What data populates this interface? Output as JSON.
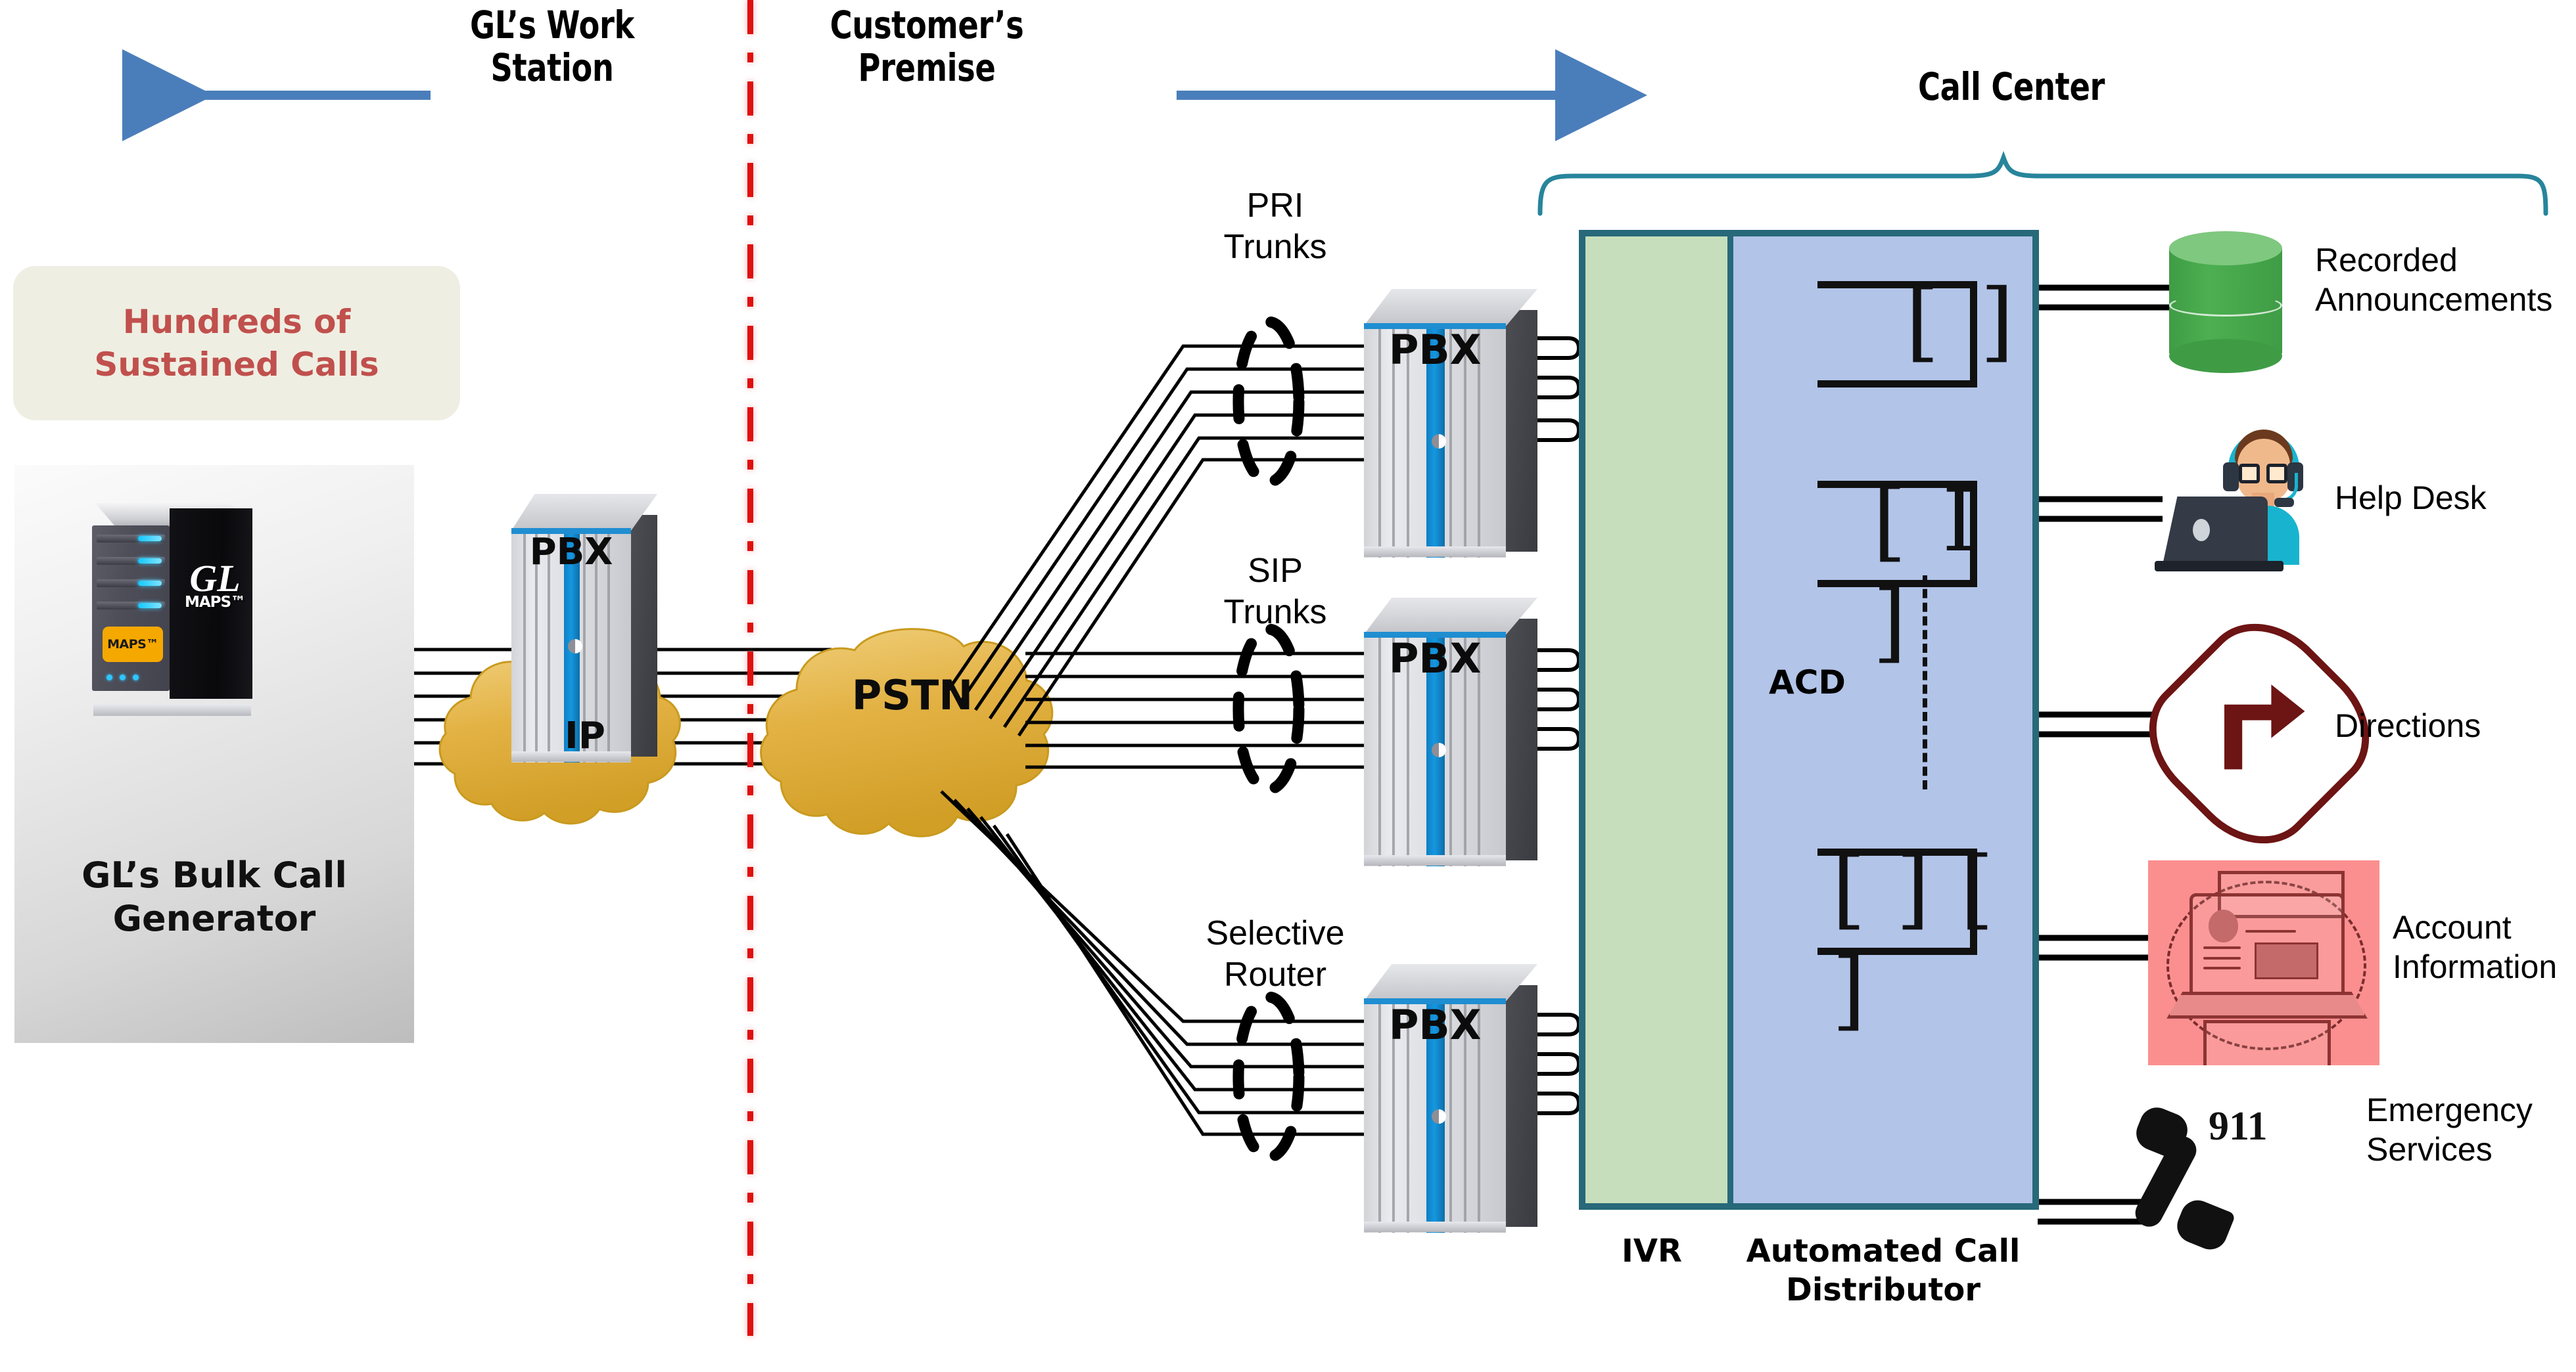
{
  "sections": {
    "workstation": {
      "title": "GL’s Work\nStation",
      "arrow": "left-arrow"
    },
    "premise": {
      "title": "Customer’s\nPremise",
      "arrow": "right-arrow"
    },
    "callcenter": {
      "title": "Call Center",
      "brace": "curly-brace"
    }
  },
  "callout": {
    "text": "Hundreds of\nSustained Calls"
  },
  "generator": {
    "caption": "GL’s Bulk Call\nGenerator",
    "logo_main": "GL",
    "logo_sub": "MAPS™",
    "badge": "MAPS™"
  },
  "clouds": [
    {
      "name": "ip-cloud",
      "label": "IP",
      "color": "#e0ad3c"
    },
    {
      "name": "pstn-cloud",
      "label": "PSTN",
      "color": "#e0ad3c"
    }
  ],
  "edge_pbx": {
    "label": "PBX"
  },
  "trunks": [
    {
      "label": "PRI\nTrunks",
      "pbx_label": "PBX"
    },
    {
      "label": "SIP\nTrunks",
      "pbx_label": "PBX"
    },
    {
      "label": "Selective\nRouter",
      "pbx_label": "PBX"
    }
  ],
  "switch": {
    "ivr_label": "IVR",
    "acd_inner_label": "ACD",
    "acd_label": "Automated Call\nDistributor",
    "ivr_color": "#c6debb",
    "acd_color": "#b2c4e8",
    "border_color": "#27697a",
    "queues": [
      {
        "name": "queue-one-agent",
        "marks": "[ ]"
      },
      {
        "name": "queue-two-agent",
        "marks": "[ I ]"
      },
      {
        "name": "queue-multi-agent",
        "marks": "[ ] [ ]"
      }
    ]
  },
  "endpoints": [
    {
      "name": "recorded-announcements",
      "label": "Recorded\nAnnouncements",
      "icon": "database-cylinder-icon",
      "color": "#4caf50"
    },
    {
      "name": "help-desk",
      "label": "Help Desk",
      "icon": "headset-agent-icon",
      "color": "#18b4cf"
    },
    {
      "name": "directions",
      "label": "Directions",
      "icon": "turn-right-sign-icon",
      "color": "#6d1414"
    },
    {
      "name": "account-information",
      "label": "Account\nInformation",
      "icon": "laptop-account-card-icon",
      "color": "#fb8f8f"
    },
    {
      "name": "emergency-services",
      "label": "Emergency\nServices",
      "icon": "phone-handset-icon",
      "badge": "911",
      "color": "#111111"
    }
  ],
  "colors": {
    "accent_blue": "#4a7ebb",
    "divider_red": "#e01010",
    "callout_bg": "#efeee2",
    "callout_text": "#c0504d",
    "brace": "#27859b"
  }
}
